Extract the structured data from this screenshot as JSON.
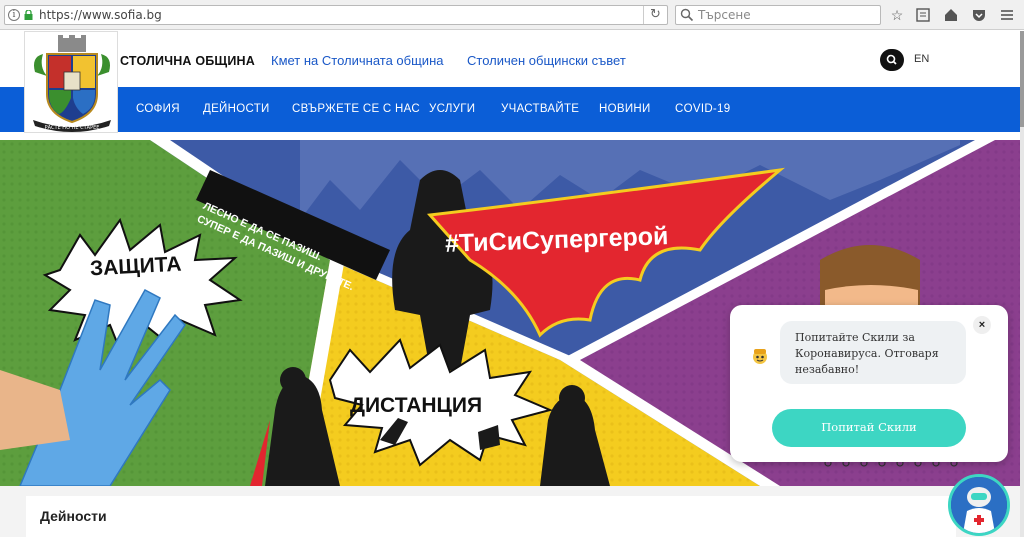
{
  "browser": {
    "url": "https://www.sofia.bg",
    "search_placeholder": "Търсене"
  },
  "header": {
    "brand": "СТОЛИЧНА ОБЩИНА",
    "links": [
      "Кмет на Столичната община",
      "Столичен общински съвет"
    ],
    "lang": "EN"
  },
  "nav": {
    "items": [
      "СОФИЯ",
      "ДЕЙНОСТИ",
      "СВЪРЖЕТЕ СЕ С НАС",
      "УСЛУГИ",
      "УЧАСТВАЙТЕ",
      "НОВИНИ",
      "COVID-19"
    ]
  },
  "hero": {
    "hashtag": "#ТиСиСупергерой",
    "banner_line1": "ЛЕСНО Е ДА СЕ ПАЗИШ.",
    "banner_line2": "СУПЕР Е ДА ПАЗИШ И ДРУГИТЕ.",
    "label_protection": "ЗАЩИТА",
    "label_distance": "ДИСТАНЦИЯ"
  },
  "section": {
    "title": "Дейности"
  },
  "chat": {
    "message": "Попитайте Скили за Коронавируса. Отговаря незабавно!",
    "button": "Попитай Скили",
    "close": "×"
  },
  "colors": {
    "nav_blue": "#0b5ed7",
    "link_blue": "#1a58c7",
    "chat_teal": "#3dd6c3",
    "hero_green": "#5d9e3e",
    "hero_yellow": "#f4cc1f",
    "hero_purple": "#8b3f8e",
    "hero_blue": "#3d5aa6",
    "cape_red": "#e3262f"
  }
}
